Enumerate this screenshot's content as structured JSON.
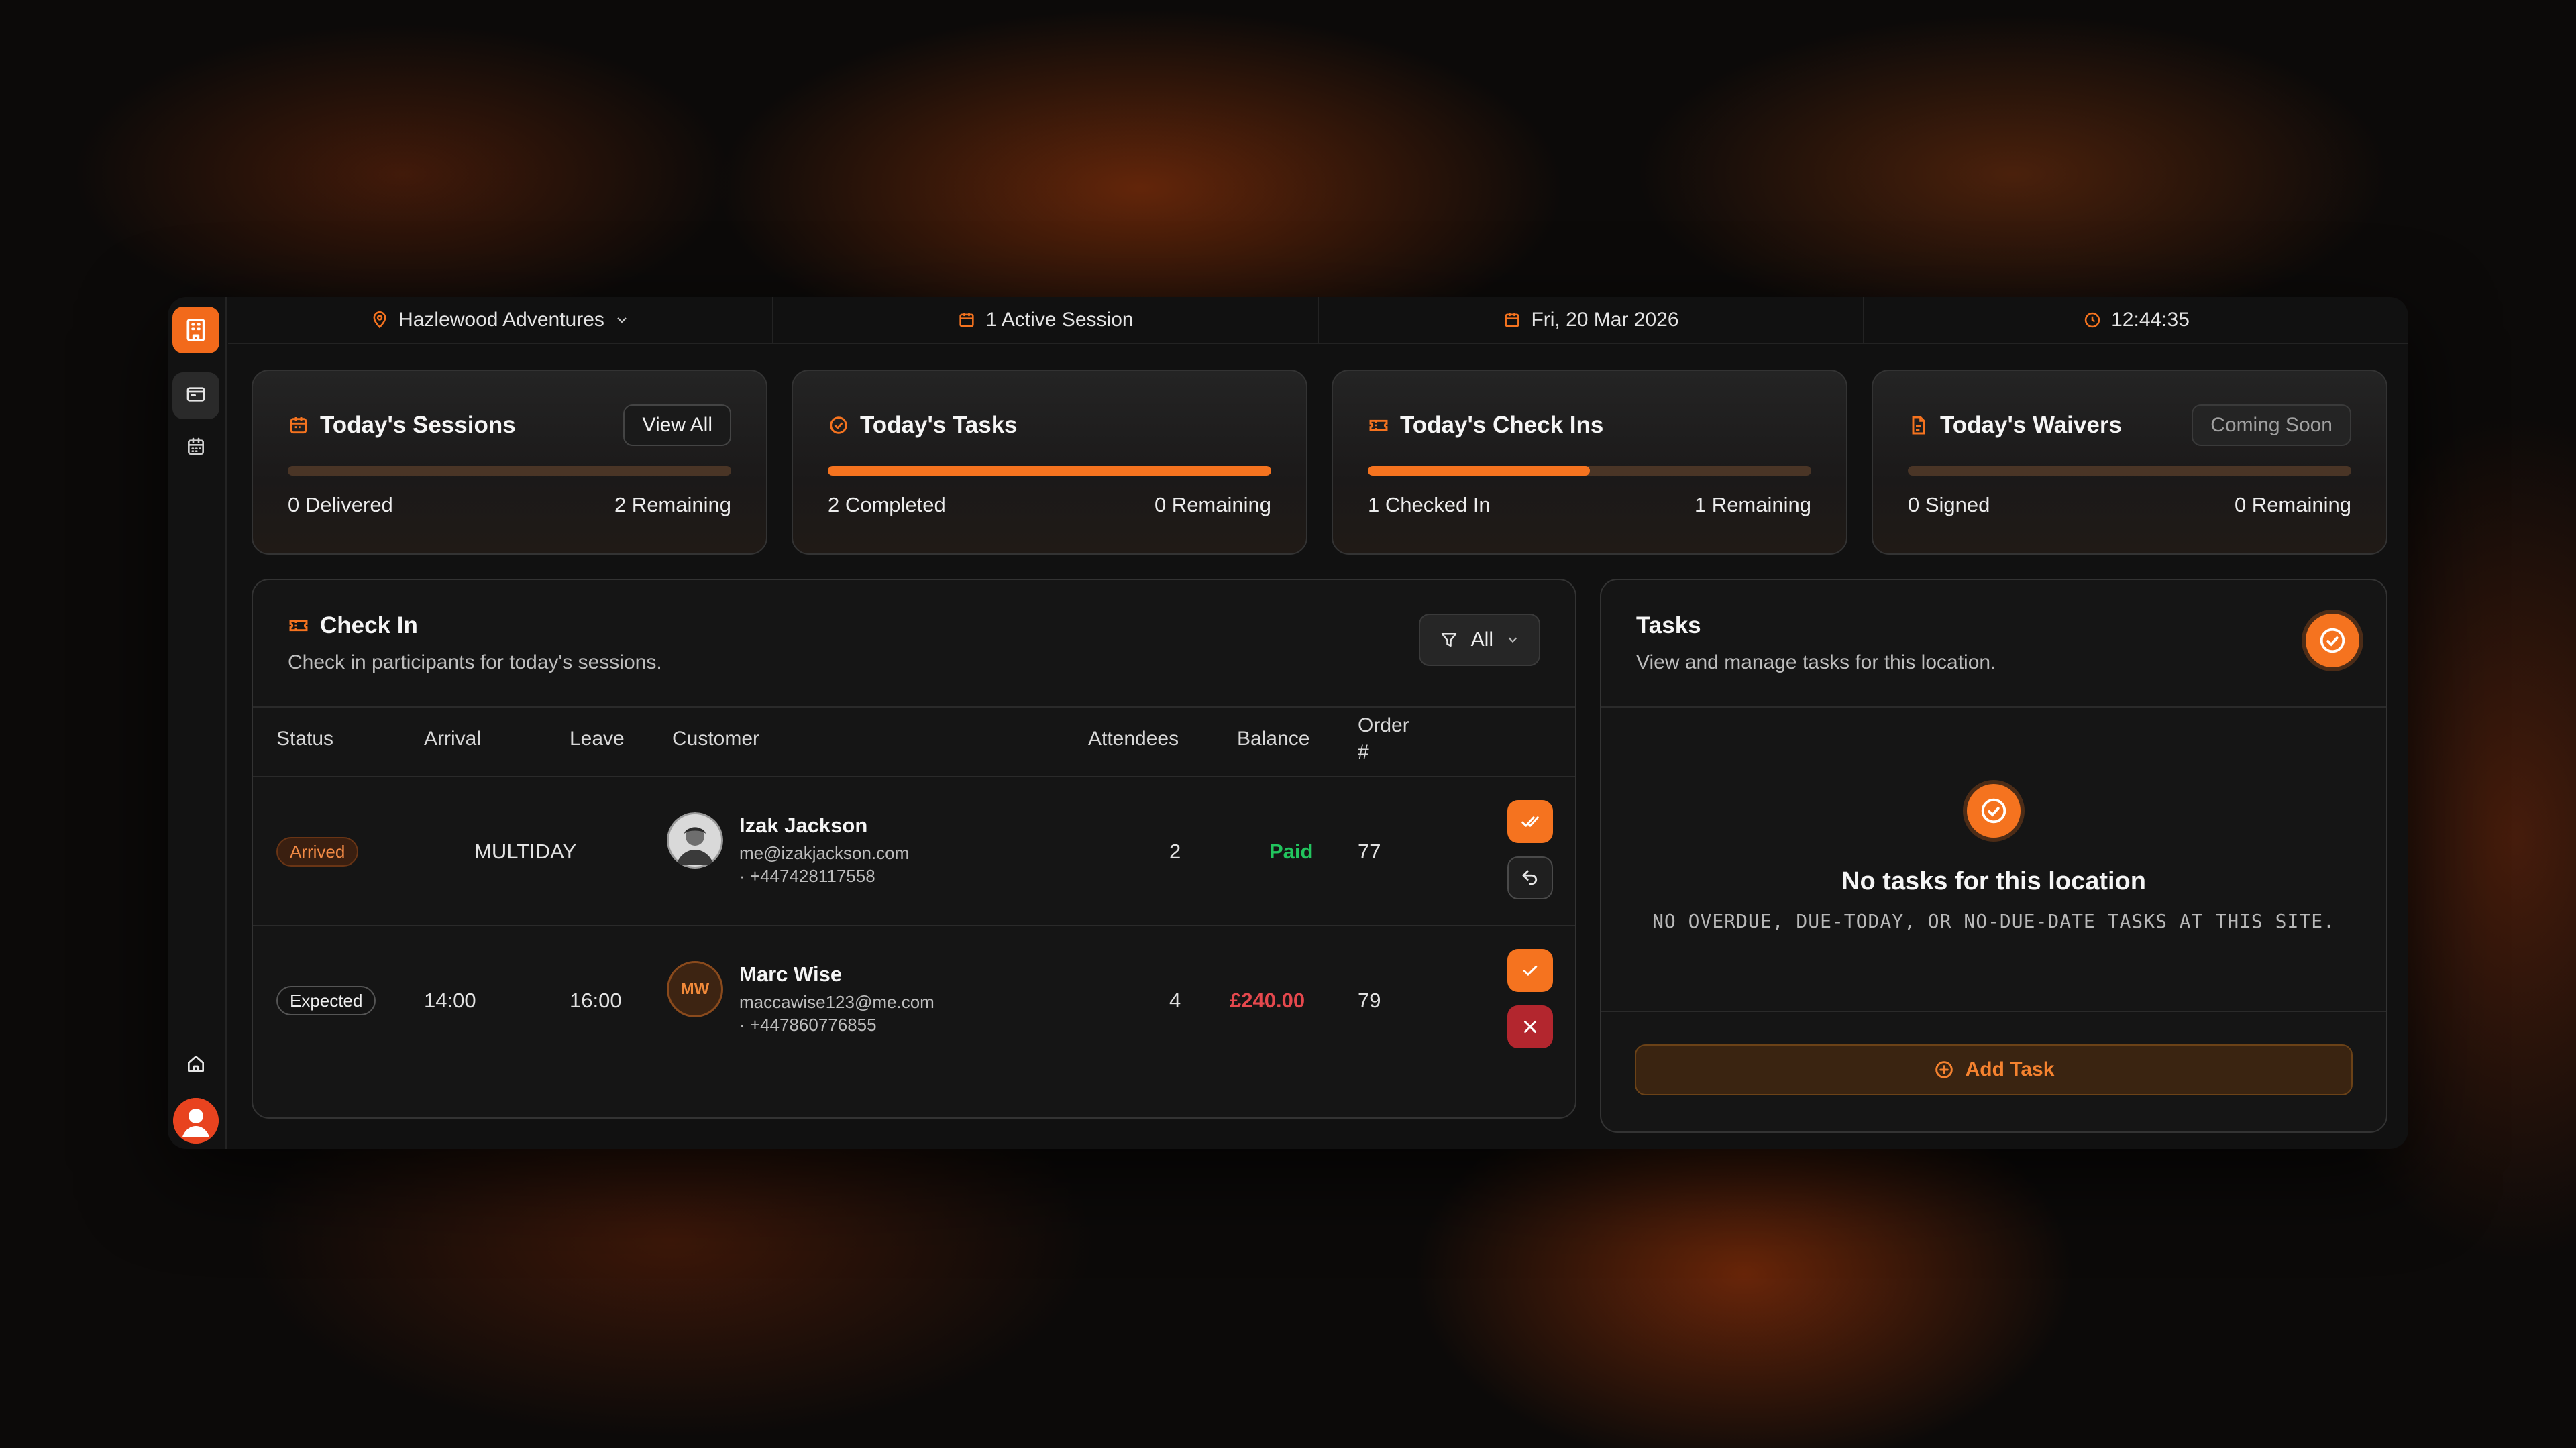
{
  "topbar": {
    "location": "Hazlewood Adventures",
    "session": "1 Active Session",
    "date": "Fri, 20 Mar 2026",
    "time": "12:44:35"
  },
  "cards": [
    {
      "title": "Today's Sessions",
      "button": "View All",
      "progress_fraction": 0,
      "left": "0 Delivered",
      "right": "2 Remaining"
    },
    {
      "title": "Today's Tasks",
      "progress_fraction": 1,
      "left": "2 Completed",
      "right": "0 Remaining"
    },
    {
      "title": "Today's Check Ins",
      "progress_fraction": 0.5,
      "left": "1 Checked In",
      "right": "1 Remaining"
    },
    {
      "title": "Today's Waivers",
      "button": "Coming Soon",
      "progress_fraction": 0,
      "left": "0 Signed",
      "right": "0 Remaining"
    }
  ],
  "checkin": {
    "title": "Check In",
    "subtitle": "Check in participants for today's sessions.",
    "filter": "All",
    "columns": {
      "status": "Status",
      "arrival": "Arrival",
      "leave": "Leave",
      "customer": "Customer",
      "attendees": "Attendees",
      "balance": "Balance",
      "order_line1": "Order",
      "order_line2": "#"
    },
    "rows": [
      {
        "status": "Arrived",
        "arrival": "MULTIDAY",
        "leave": "",
        "name": "Izak Jackson",
        "email": "me@izakjackson.com",
        "phone": "· +447428117558",
        "attendees": "2",
        "balance": "Paid",
        "order": "77",
        "initials": ""
      },
      {
        "status": "Expected",
        "arrival": "14:00",
        "leave": "16:00",
        "name": "Marc Wise",
        "email": "maccawise123@me.com",
        "phone": "· +447860776855",
        "attendees": "4",
        "balance": "£240.00",
        "order": "79",
        "initials": "MW"
      }
    ]
  },
  "tasks": {
    "title": "Tasks",
    "subtitle": "View and manage tasks for this location.",
    "empty_title": "No tasks for this location",
    "empty_sub": "NO OVERDUE, DUE-TODAY, OR NO-DUE-DATE TASKS AT THIS SITE.",
    "add_label": "Add Task"
  },
  "colors": {
    "accent": "#f5731f",
    "paid": "#22c55e",
    "due": "#e5484d"
  }
}
